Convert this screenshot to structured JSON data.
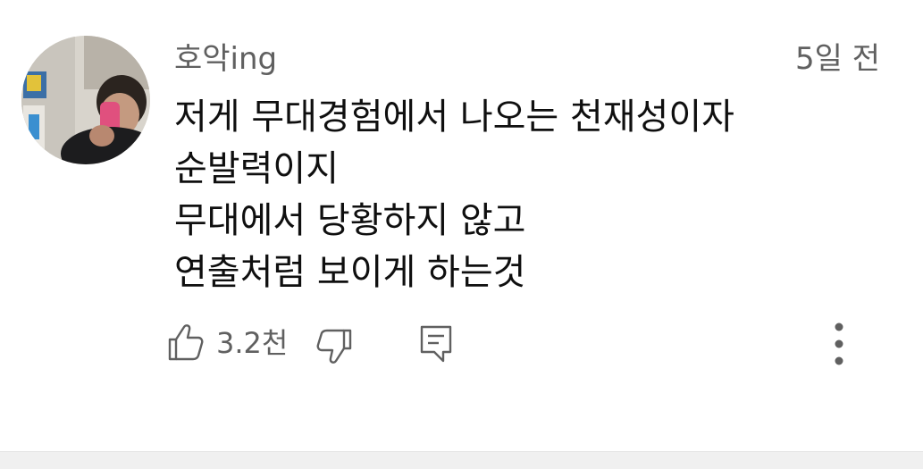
{
  "comment": {
    "author": "호악ing",
    "timestamp": "5일 전",
    "lines": [
      "저게 무대경험에서 나오는 천재성이자",
      "순발력이지",
      "무대에서 당황하지 않고",
      "연출처럼 보이게 하는것"
    ],
    "like_count": "3.2천"
  },
  "icons": {
    "like": "thumbs-up-icon",
    "dislike": "thumbs-down-icon",
    "reply": "reply-comment-icon",
    "more": "more-vertical-icon"
  },
  "colors": {
    "text_primary": "#0f0f0f",
    "text_secondary": "#606060",
    "background": "#ffffff"
  }
}
